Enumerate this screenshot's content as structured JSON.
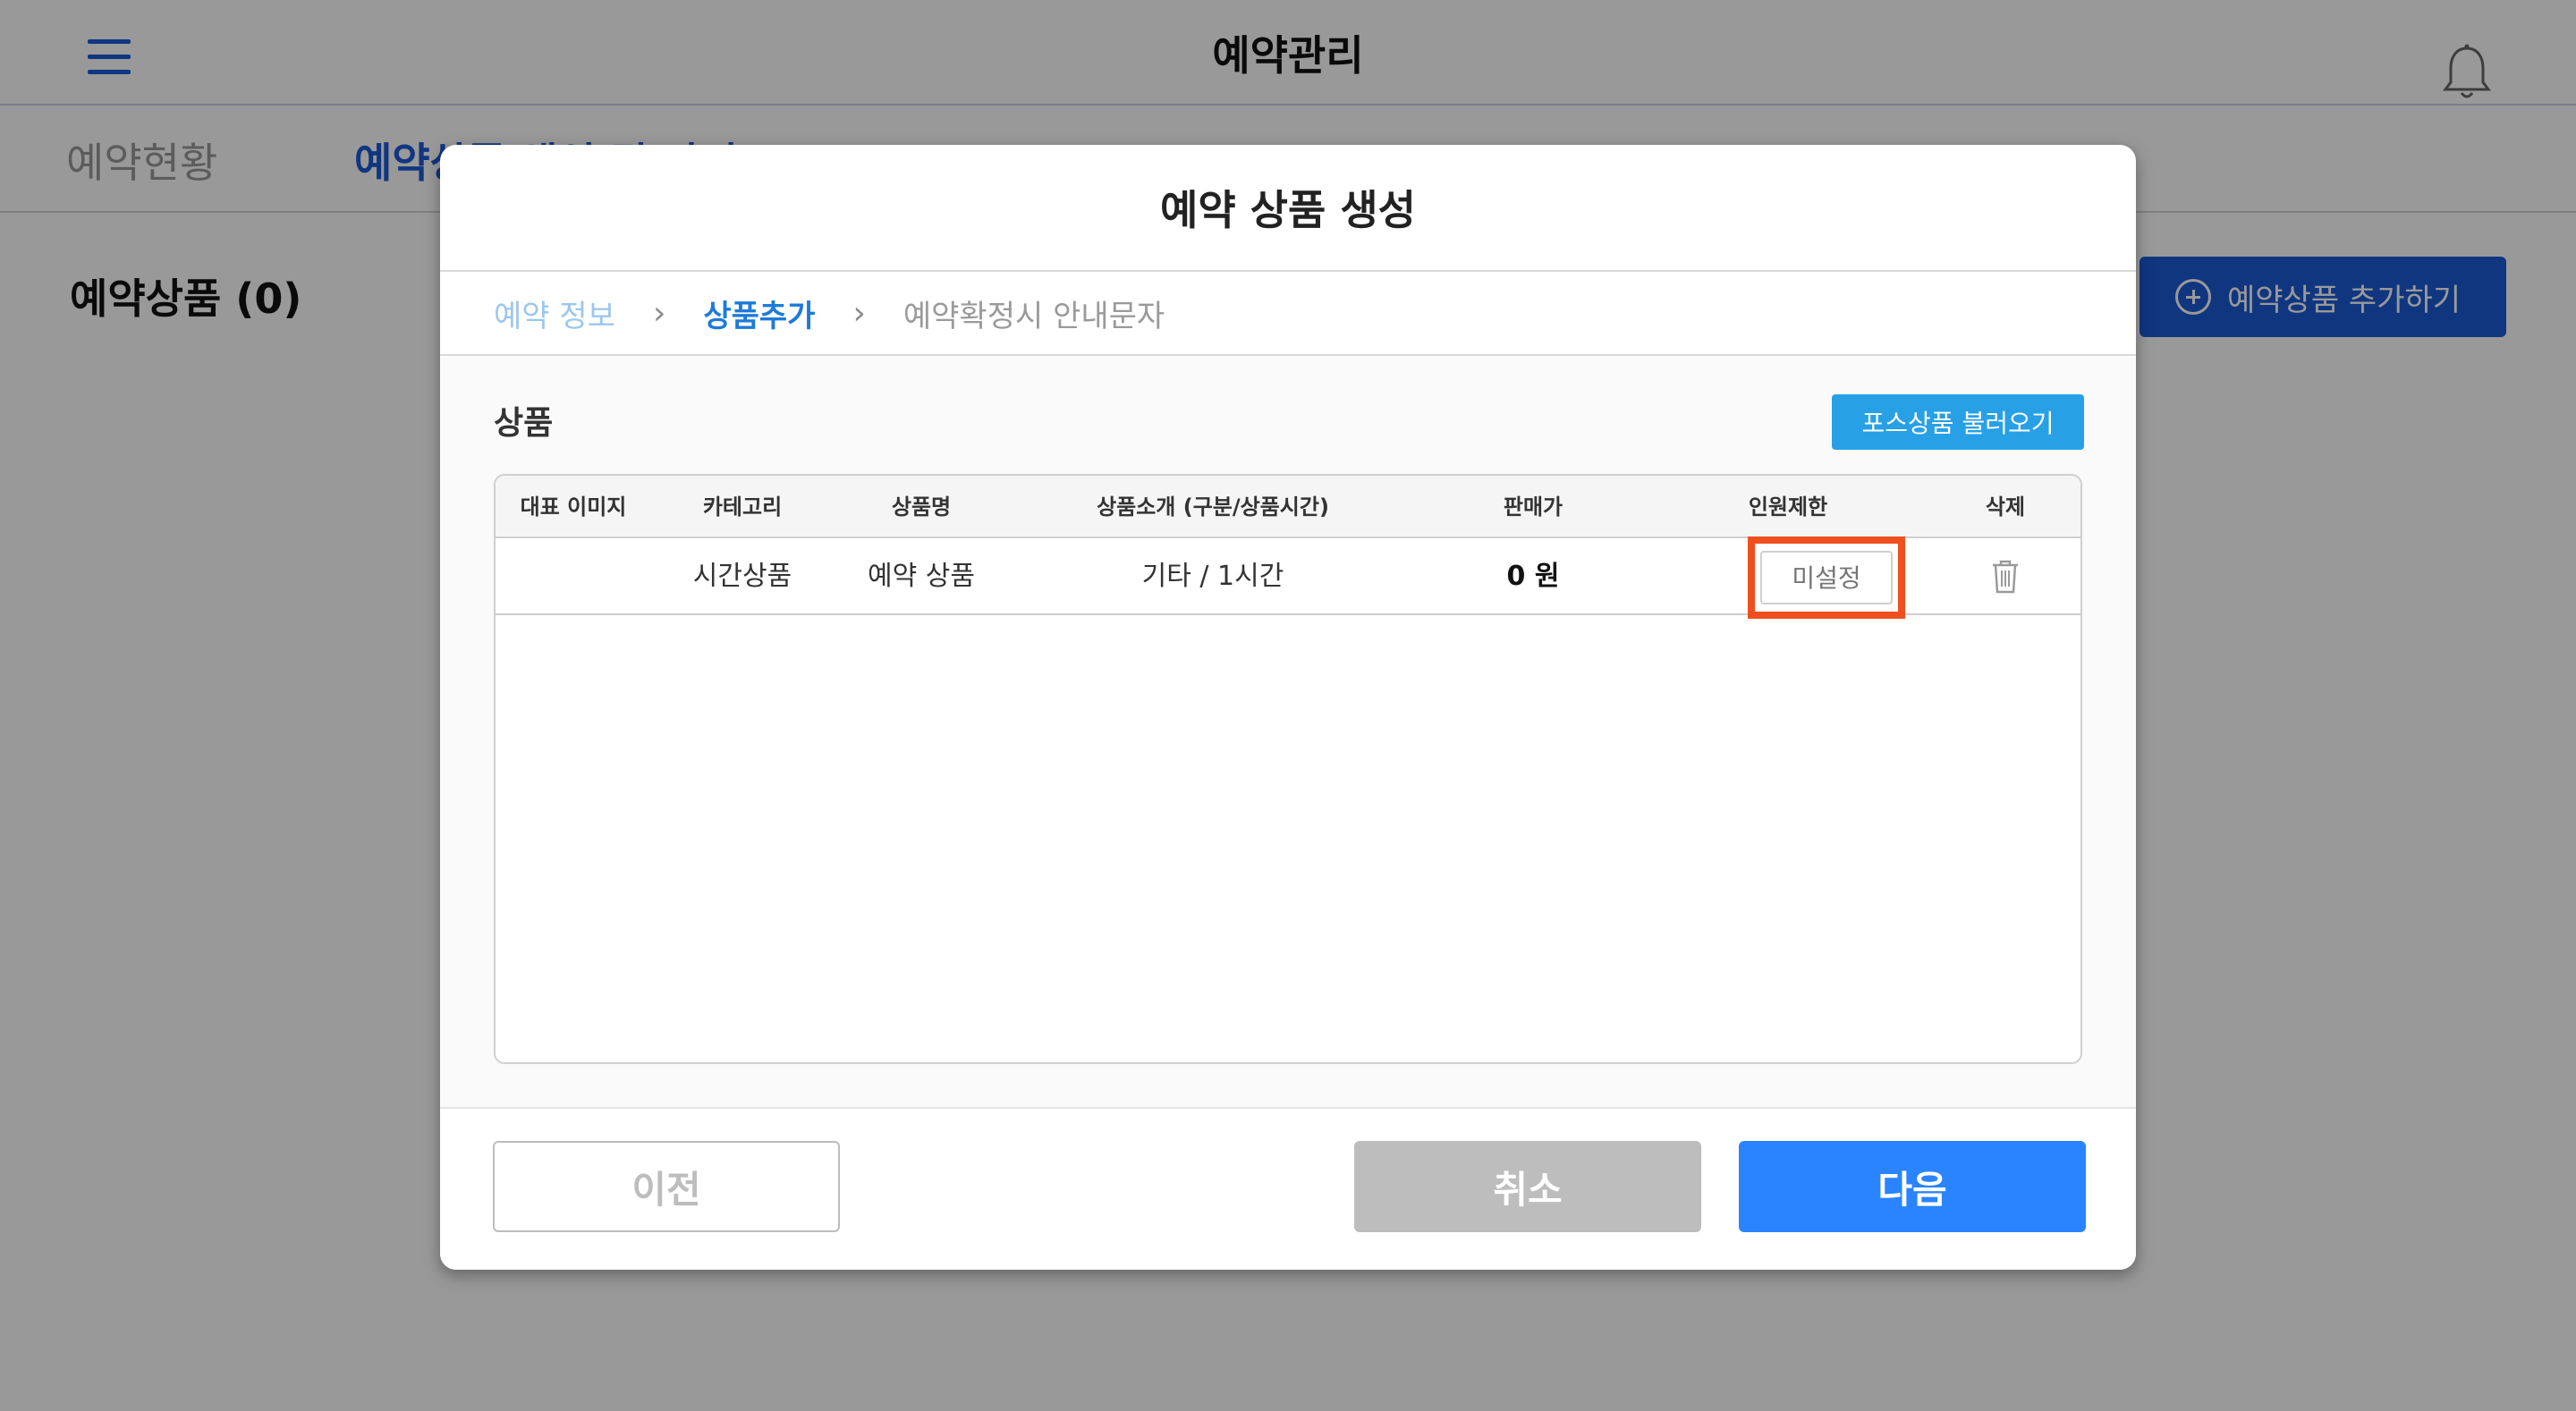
{
  "app": {
    "title": "예약관리",
    "tabs": [
      {
        "label": "예약현황"
      },
      {
        "label": "예약상품 생성 및 관리"
      }
    ],
    "product_count_label": "예약상품 (0)",
    "add_product_label": "예약상품 추가하기"
  },
  "modal": {
    "title": "예약 상품 생성",
    "steps": [
      {
        "label": "예약 정보",
        "state": "done"
      },
      {
        "label": "상품추가",
        "state": "active"
      },
      {
        "label": "예약확정시 안내문자",
        "state": "next"
      }
    ],
    "section_title": "상품",
    "pos_button_label": "포스상품 불러오기",
    "table": {
      "headers": [
        "대표 이미지",
        "카테고리",
        "상품명",
        "상품소개 (구분/상품시간)",
        "판매가",
        "인원제한",
        "삭제"
      ],
      "rows": [
        {
          "image": "",
          "category": "시간상품",
          "name": "예약 상품",
          "intro": "기타 / 1시간",
          "price": "0 원",
          "limit_placeholder": "미설정"
        }
      ]
    },
    "footer": {
      "prev_label": "이전",
      "cancel_label": "취소",
      "next_label": "다음"
    }
  },
  "colors": {
    "brand_blue": "#1c5bd6",
    "next_button": "#2a84ff",
    "pos_button": "#27a0e6",
    "highlight": "#ef4f1f"
  }
}
